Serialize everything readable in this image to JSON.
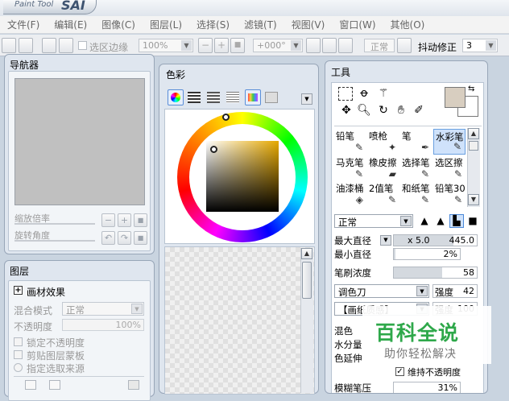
{
  "app": {
    "logo_small": "Paint Tool",
    "logo_big": "SAI"
  },
  "menu": [
    {
      "label": "文件(F)"
    },
    {
      "label": "编辑(E)"
    },
    {
      "label": "图像(C)"
    },
    {
      "label": "图层(L)"
    },
    {
      "label": "选择(S)"
    },
    {
      "label": "滤镜(T)"
    },
    {
      "label": "视图(V)"
    },
    {
      "label": "窗口(W)"
    },
    {
      "label": "其他(O)"
    }
  ],
  "toolbar": {
    "select_edge_label": "选区边缘",
    "zoom_value": "100%",
    "rotate_value": "+000°",
    "blend_value": "正常",
    "stabilizer_label": "抖动修正",
    "stabilizer_value": "3",
    "btn_minus": "−",
    "btn_plus": "+",
    "btn_reset": "■"
  },
  "navigator": {
    "title": "导航器",
    "zoom_label": "缩放倍率",
    "rotate_label": "旋转角度",
    "btn_minus": "−",
    "btn_plus": "+",
    "btn_reset": "■"
  },
  "layers": {
    "title": "图层",
    "effect_label": "画材效果",
    "blend_mode_label": "混合模式",
    "blend_mode_value": "正常",
    "opacity_label": "不透明度",
    "opacity_value": "100%",
    "checkboxes": [
      {
        "label": "锁定不透明度"
      },
      {
        "label": "剪贴图层蒙板"
      },
      {
        "label": "指定选取来源"
      }
    ]
  },
  "color": {
    "title": "色彩",
    "accent": "#3e5370"
  },
  "tools": {
    "title": "工具",
    "brush_cells": [
      {
        "label": "铅笔",
        "icon": "pencil-icon",
        "glyph": "✎"
      },
      {
        "label": "喷枪",
        "icon": "airbrush-icon",
        "glyph": "✦"
      },
      {
        "label": "笔",
        "icon": "pen-icon",
        "glyph": "✒"
      },
      {
        "label": "水彩笔",
        "icon": "watercolor-icon",
        "glyph": "✎"
      },
      {
        "label": "马克笔",
        "icon": "marker-icon",
        "glyph": "✎"
      },
      {
        "label": "橡皮擦",
        "icon": "eraser-icon",
        "glyph": "▰"
      },
      {
        "label": "选择笔",
        "icon": "select-pen-icon",
        "glyph": "✎"
      },
      {
        "label": "选区擦",
        "icon": "select-eraser-icon",
        "glyph": "✎"
      },
      {
        "label": "油漆桶",
        "icon": "bucket-icon",
        "glyph": "◈"
      },
      {
        "label": "2值笔",
        "icon": "binary-pen-icon",
        "glyph": "✎"
      },
      {
        "label": "和纸笔",
        "icon": "washi-pen-icon",
        "glyph": "✎"
      },
      {
        "label": "铅笔30",
        "icon": "pencil30-icon",
        "glyph": "✎"
      }
    ],
    "blend_value": "正常",
    "max_size_label": "最大直径",
    "max_size_mult": "x 5.0",
    "max_size_value": "445.0",
    "max_size_frac": 0.72,
    "min_size_label": "最小直径",
    "min_size_value": "2%",
    "min_size_frac": 0.02,
    "density_label": "笔刷浓度",
    "density_value": "58",
    "density_frac": 0.58,
    "palette_knife_value": "调色刀",
    "strength_label": "强度",
    "strength_value": "42",
    "texture_value": "【画纸质感】",
    "strength2_label": "强度",
    "strength2_value": "100",
    "blending_label": "混色",
    "water_label": "水分量",
    "color_extend_label": "色延伸",
    "keep_opacity_label": "维持不透明度",
    "blur_label": "模糊笔压",
    "blur_value": "31%"
  },
  "watermark": {
    "title": "百科全说",
    "subtitle": "助你轻松解决"
  }
}
